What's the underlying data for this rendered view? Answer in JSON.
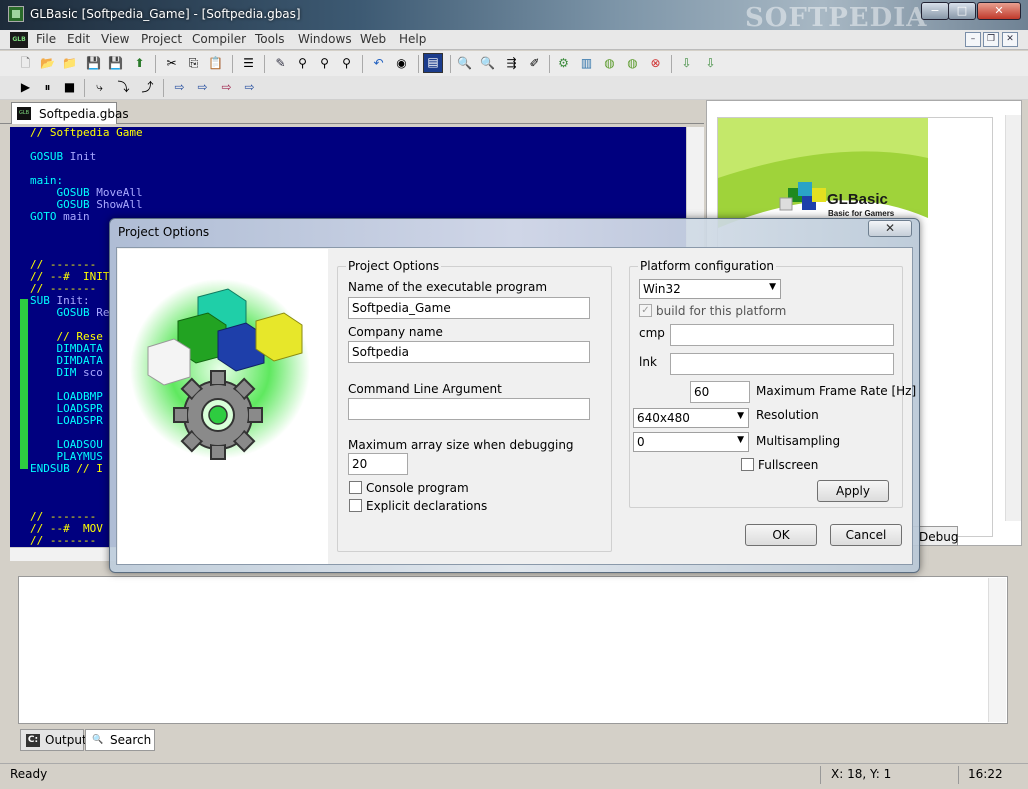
{
  "window": {
    "title": "GLBasic [Softpedia_Game] - [Softpedia.gbas]",
    "watermark": "SOFTPEDIA",
    "minimize_glyph": "−",
    "maximize_glyph": "□",
    "close_glyph": "✕"
  },
  "menubar": {
    "logo": "GLB",
    "items": [
      "File",
      "Edit",
      "View",
      "Project",
      "Compiler",
      "Tools",
      "Windows",
      "Web",
      "Help"
    ],
    "mdi_min": "–",
    "mdi_restore": "❐",
    "mdi_close": "✕"
  },
  "file_tab": {
    "icon": "GLB",
    "label": "Softpedia.gbas"
  },
  "editor": {
    "code": "// Softpedia Game\n\nGOSUB Init\n\nmain:\n    GOSUB MoveAll\n    GOSUB ShowAll\nGOTO main\n\n\n\n// -------\n// --#  INIT\n// -------\nSUB Init:\n    GOSUB Re\n\n    // Rese\n    DIMDATA\n    DIMDATA\n    DIM sco\n\n    LOADBMP\n    LOADSPR\n    LOADSPR\n\n    LOADSOU\n    PLAYMUS\nENDSUB // I\n\n\n\n// -------\n// --#  MOV\n// -------"
  },
  "right_panel": {
    "brand": "GLBasic",
    "tagline": "Basic for Gamers",
    "debug_tab": "Debug"
  },
  "dialog": {
    "title": "Project Options",
    "close_glyph": "✕",
    "left_group": {
      "legend": "Project Options",
      "exe_name_label": "Name of the executable program",
      "exe_name_value": "Softpedia_Game",
      "company_label": "Company name",
      "company_value": "Softpedia",
      "cmdline_label": "Command Line Argument",
      "cmdline_value": "",
      "array_label": "Maximum array size when debugging",
      "array_value": "20",
      "console_label": "Console program",
      "console_checked": false,
      "explicit_label": "Explicit declarations",
      "explicit_checked": false
    },
    "platform_group": {
      "legend": "Platform configuration",
      "platform_value": "Win32",
      "build_label": "build for this platform",
      "build_checked": true,
      "cmp_label": "cmp",
      "cmp_value": "",
      "lnk_label": "lnk",
      "lnk_value": "",
      "framerate_value": "60",
      "framerate_label": "Maximum Frame Rate [Hz]",
      "resolution_value": "640x480",
      "resolution_label": "Resolution",
      "multisampling_value": "0",
      "multisampling_label": "Multisampling",
      "fullscreen_label": "Fullscreen",
      "fullscreen_checked": false,
      "apply_label": "Apply"
    },
    "ok_label": "OK",
    "cancel_label": "Cancel"
  },
  "bottom_tabs": [
    {
      "icon": "C:",
      "label": "Output"
    },
    {
      "icon": "🔍",
      "label": "Search"
    }
  ],
  "status": {
    "ready": "Ready",
    "position": "X: 18, Y:  1",
    "time": "16:22"
  },
  "colors": {
    "editor_bg": "#00007f",
    "code_comment": "#ffff00",
    "code_keyword": "#00ffff",
    "brand_green": "#9fd33a"
  }
}
